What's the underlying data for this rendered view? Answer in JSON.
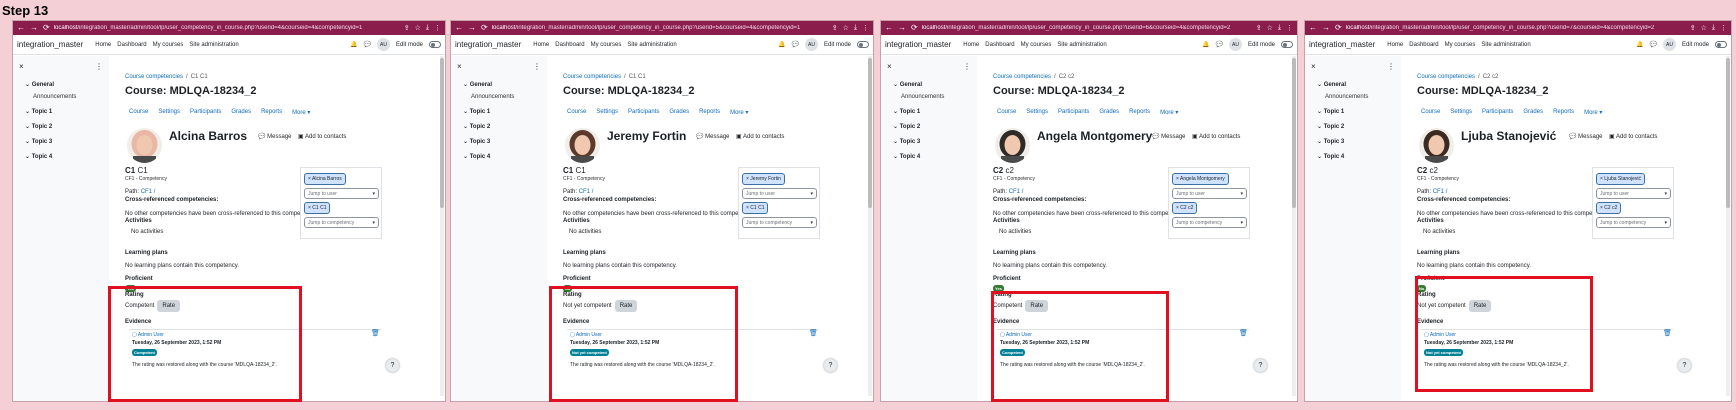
{
  "step_title": "Step 13",
  "common": {
    "chrome_url_host": "localhost",
    "topbar": {
      "site_name": "integration_master",
      "nav": [
        "Home",
        "Dashboard",
        "My courses",
        "Site administration"
      ],
      "user_initials": "AU",
      "edit_mode_label": "Edit mode"
    },
    "drawer": {
      "close": "×",
      "menu": "⋮",
      "sections": [
        "General",
        "Topic 1",
        "Topic 2",
        "Topic 3",
        "Topic 4"
      ],
      "sub_items": [
        "Announcements"
      ]
    },
    "breadcrumb_root": "Course competencies",
    "course_title": "Course: MDLQA-18234_2",
    "tabs": [
      "Course",
      "Settings",
      "Participants",
      "Grades",
      "Reports",
      "More ▾"
    ],
    "message_label": "Message",
    "contacts_label": "Add to contacts",
    "competency_framework": "CF1 - Competency",
    "path_label": "Path:",
    "path_link": "CF1 /",
    "xref_heading": "Cross-referenced competencies:",
    "xref_text": "No other competencies have been cross-referenced to this competency.",
    "activities_heading": "Activities",
    "no_activities": "No activities",
    "learning_plans_heading": "Learning plans",
    "learning_plans_text": "No learning plans contain this competency.",
    "jump_user_placeholder": "Jump to user",
    "jump_comp_placeholder": "Jump to competency",
    "proficient_label": "Proficient",
    "rating_label": "Rating",
    "rate_button": "Rate",
    "evidence_heading": "Evidence",
    "evidence_user": "Admin User",
    "evidence_date": "Tuesday, 26 September 2023, 1:52 PM",
    "evidence_text": "The rating was restored along with the course 'MDLQA-18234_2'.",
    "help": "?"
  },
  "panels": [
    {
      "url_path": "/integration_master/admin/tool/lp/user_competency_in_course.php?userid=4&courseid=4&competencyid=1",
      "breadcrumb_current": "C1 C1",
      "user_name": "Alcina Barros",
      "competency_code": "C1",
      "competency_name": "C1",
      "user_chip": "× Alcina Barros",
      "comp_chip": "× C1 C1",
      "proficient_badge": "Yes",
      "rating_value": "Competent",
      "evidence_badge": "Competent",
      "evidence_badge_color": "#008196",
      "avatar_color": "#e8b7a6"
    },
    {
      "url_path": "/integration_master/admin/tool/lp/user_competency_in_course.php?userid=5&courseid=4&competencyid=1",
      "breadcrumb_current": "C1 C1",
      "user_name": "Jeremy Fortin",
      "competency_code": "C1",
      "competency_name": "C1",
      "user_chip": "× Jeremy Fortin",
      "comp_chip": "× C1 C1",
      "proficient_badge": "No",
      "rating_value": "Not yet competent",
      "evidence_badge": "Not yet competent",
      "evidence_badge_color": "#008196",
      "avatar_color": "#5b3a2c"
    },
    {
      "url_path": "/integration_master/admin/tool/lp/user_competency_in_course.php?userid=6&courseid=4&competencyid=2",
      "breadcrumb_current": "C2 c2",
      "user_name": "Angela Montgomery",
      "competency_code": "C2",
      "competency_name": "c2",
      "user_chip": "× Angela Montgomery",
      "comp_chip": "× C2 c2",
      "proficient_badge": "Yes",
      "rating_value": "Competent",
      "evidence_badge": "Competent",
      "evidence_badge_color": "#008196",
      "avatar_color": "#2f2a28"
    },
    {
      "url_path": "/integration_master/admin/tool/lp/user_competency_in_course.php?userid=7&courseid=4&competencyid=2",
      "breadcrumb_current": "C2 c2",
      "user_name": "Ljuba Stanojević",
      "competency_code": "C2",
      "competency_name": "c2",
      "user_chip": "× Ljuba Stanojević",
      "comp_chip": "× C2 c2",
      "proficient_badge": "No",
      "rating_value": "Not yet competent",
      "evidence_badge": "Not yet competent",
      "evidence_badge_color": "#008196",
      "avatar_color": "#3a2a22"
    }
  ]
}
